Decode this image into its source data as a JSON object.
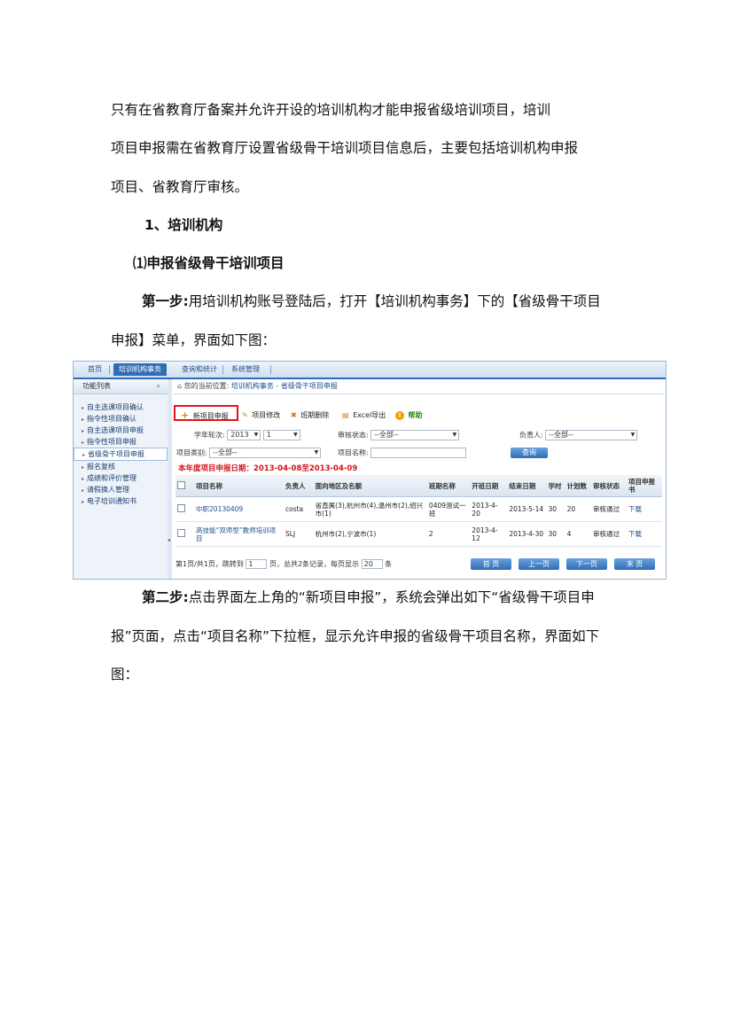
{
  "doc": {
    "p1_lines": [
      "只有在省教育厅备案并允许开设的培训机构才能申报省级培训项目，培训",
      "项目申报需在省教育厅设置省级骨干培训项目信息后，主要包括培训机构申报",
      "项目、省教育厅审核。"
    ],
    "h1": "1、培训机构",
    "h2": "⑴申报省级骨干培训项目",
    "step1_label": "第一步:",
    "step1_line1": "用培训机构账号登陆后，打开【培训机构事务】下的【省级骨干项目",
    "step1_line2": "申报】菜单，界面如下图：",
    "step2_label": "第二步:",
    "step2_line1": "点击界面左上角的“新项目申报”，系统会弹出如下“省级骨干项目申",
    "step2_line2": "报”页面，点击“项目名称”下拉框，显示允许申报的省级骨干项目名称，界面如下",
    "step2_line3": "图："
  },
  "screenshot": {
    "tabs": [
      "首页",
      "培训机构事务",
      "查询和统计",
      "系统管理"
    ],
    "sidebar_title": "功能列表",
    "sidebar_items": [
      "自主选课项目确认",
      "指令性项目确认",
      "自主选课项目申报",
      "指令性项目申报",
      "省级骨干项目申报",
      "报名复核",
      "成绩和评价管理",
      "请假换人管理",
      "电子培训通知书"
    ],
    "breadcrumb_prefix": "您的当前位置:",
    "breadcrumb_path": "培训机构事务 - 省级骨干项目申报",
    "toolbar": {
      "new": "新项目申报",
      "edit": "项目修改",
      "delete": "班期删除",
      "export": "Excel导出",
      "help": "帮助"
    },
    "filters": {
      "year_label": "学年轮次:",
      "year_value": "2013",
      "round_value": "1",
      "status_label": "审核状态:",
      "status_value": "--全部--",
      "owner_label": "负责人:",
      "owner_value": "--全部--",
      "category_label": "项目类别:",
      "category_value": "--全部--",
      "name_label": "项目名称:",
      "query_button": "查询"
    },
    "notice": "本年度项目申报日期：2013-04-08至2013-04-09",
    "columns": [
      "项目名称",
      "负责人",
      "面向地区及名额",
      "班期名称",
      "开班日期",
      "结束日期",
      "学时",
      "计划数",
      "审核状态",
      "项目申报书"
    ],
    "rows": [
      [
        "中职20130409",
        "costa",
        "省直属(3),杭州市(4),温州市(2),绍兴市(1)",
        "0409测试一班",
        "2013-4-20",
        "2013-5-14",
        "30",
        "20",
        "审核通过",
        "下载"
      ],
      [
        "高技能“双师型”教师培训项目",
        "SLJ",
        "杭州市(2),宁波市(1)",
        "2",
        "2013-4-12",
        "2013-4-30",
        "30",
        "4",
        "审核通过",
        "下载"
      ]
    ],
    "pager": {
      "info": "第1页/共1页，跳转到",
      "page_input": "1",
      "summary": "页，总共2条记录，每页显示",
      "page_size": "20",
      "unit": "条",
      "first": "首 页",
      "prev": "上一页",
      "next": "下一页",
      "last": "末 页"
    },
    "colors": {
      "accent": "#2f6db5",
      "highlight": "#e0141e",
      "notice": "#d4121a"
    }
  }
}
